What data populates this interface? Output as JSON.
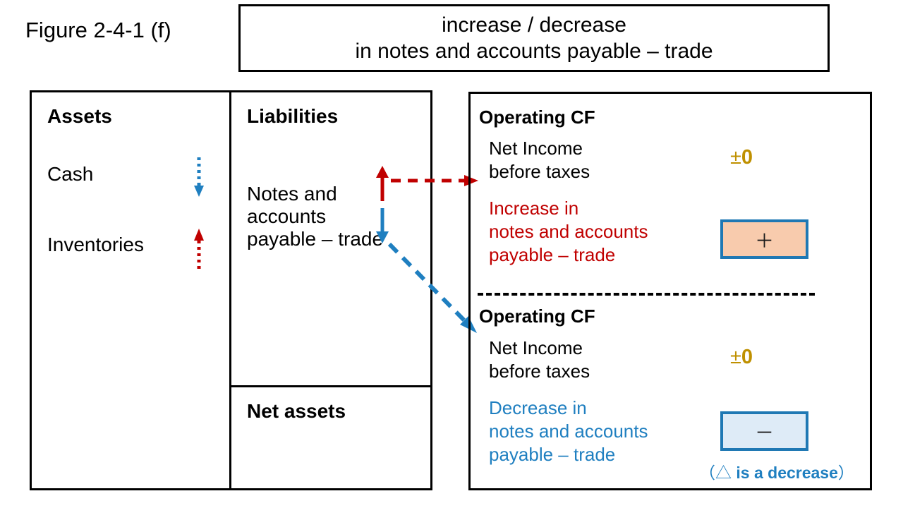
{
  "figure": {
    "label": "Figure 2-4-1 (f)"
  },
  "title_box": {
    "line1": "increase / decrease",
    "line2": "in notes and accounts payable – trade"
  },
  "balance_sheet": {
    "assets": {
      "heading": "Assets",
      "items": [
        {
          "label": "Cash",
          "arrow": "down-dotted-arrow-icon",
          "arrow_color": "#1F7FC0",
          "direction": "down"
        },
        {
          "label": "Inventories",
          "arrow": "up-dotted-arrow-icon",
          "arrow_color": "#C00000",
          "direction": "up"
        }
      ]
    },
    "liabilities": {
      "heading": "Liabilities",
      "item_line1": "Notes and",
      "item_line2": "accounts",
      "item_line3": "payable – trade",
      "arrow_up": "up-solid-arrow-icon",
      "arrow_up_color": "#C00000",
      "arrow_down": "down-solid-arrow-icon",
      "arrow_down_color": "#1F7FC0"
    },
    "net_assets": {
      "heading": "Net assets"
    }
  },
  "connectors": [
    {
      "name": "red-dashed-connector-arrow",
      "color": "#C00000",
      "from": "liabilities-increase-arrow",
      "to": "operating-cf-top"
    },
    {
      "name": "blue-dashed-connector-arrow",
      "color": "#1F7FC0",
      "from": "liabilities-decrease-arrow",
      "to": "operating-cf-bottom"
    }
  ],
  "cash_flow": {
    "top": {
      "heading": "Operating CF",
      "net_income_line1": "Net Income",
      "net_income_line2": "before taxes",
      "net_income_value_sign": "±",
      "net_income_value_number": "0",
      "net_income_value_color": "#BF9000",
      "adjustment_line1": "Increase in",
      "adjustment_line2": "notes and accounts",
      "adjustment_line3": "payable – trade",
      "adjustment_color": "#C00000",
      "adjustment_value": "＋",
      "adjustment_box_fill": "#F8CBAD",
      "adjustment_box_border": "#1F78B4"
    },
    "bottom": {
      "heading": "Operating CF",
      "net_income_line1": "Net Income",
      "net_income_line2": "before taxes",
      "net_income_value_sign": "±",
      "net_income_value_number": "0",
      "net_income_value_color": "#BF9000",
      "adjustment_line1": "Decrease in",
      "adjustment_line2": "notes and accounts",
      "adjustment_line3": "payable – trade",
      "adjustment_color": "#1F7FC0",
      "adjustment_value": "－",
      "adjustment_box_fill": "#DEEBF7",
      "adjustment_box_border": "#1F78B4",
      "note_open_paren": "（",
      "note_triangle": "△",
      "note_text": " is a decrease",
      "note_close_paren": "）",
      "note_color": "#1F7FC0"
    }
  }
}
